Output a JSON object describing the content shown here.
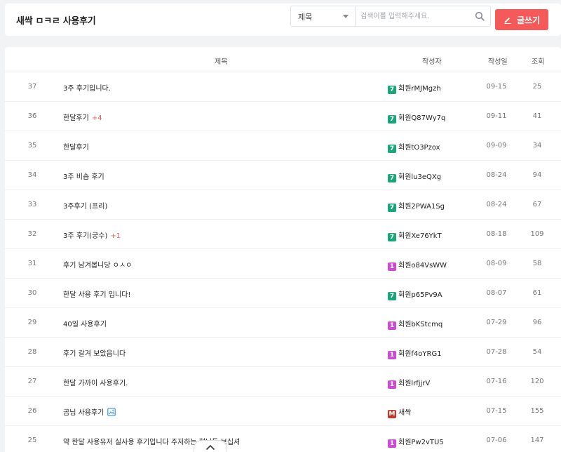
{
  "header": {
    "title": "새싹 ㅁㅋㄹ 사용후기",
    "search": {
      "scope_selected": "제목",
      "placeholder": "검색어를 입력해주세요.",
      "value": ""
    },
    "write_label": "글쓰기"
  },
  "table": {
    "columns": {
      "title": "제목",
      "author": "작성자",
      "date": "작성일",
      "views": "조회"
    },
    "rows": [
      {
        "num": "37",
        "title": "3주 후기입니다.",
        "comments": "",
        "has_image": false,
        "level": "7",
        "level_color": "#1aa67a",
        "author": "회원rMJMgzh",
        "date": "09-15",
        "views": "25"
      },
      {
        "num": "36",
        "title": "한달후기",
        "comments": "+4",
        "has_image": false,
        "level": "7",
        "level_color": "#1aa67a",
        "author": "회원Q87Wy7q",
        "date": "09-11",
        "views": "41"
      },
      {
        "num": "35",
        "title": "한달후기",
        "comments": "",
        "has_image": false,
        "level": "7",
        "level_color": "#1aa67a",
        "author": "회원tO3Pzox",
        "date": "09-09",
        "views": "34"
      },
      {
        "num": "34",
        "title": "3주 비숍 후기",
        "comments": "",
        "has_image": false,
        "level": "7",
        "level_color": "#1aa67a",
        "author": "회원lu3eQXg",
        "date": "08-24",
        "views": "94"
      },
      {
        "num": "33",
        "title": "3주후기 (프리)",
        "comments": "",
        "has_image": false,
        "level": "7",
        "level_color": "#1aa67a",
        "author": "회원2PWA1Sg",
        "date": "08-24",
        "views": "67"
      },
      {
        "num": "32",
        "title": "3주 후기(궁수)",
        "comments": "+1",
        "has_image": false,
        "level": "7",
        "level_color": "#1aa67a",
        "author": "회원Xe76YkT",
        "date": "08-18",
        "views": "109"
      },
      {
        "num": "31",
        "title": "후기 남겨봅니당 ㅇㅅㅇ",
        "comments": "",
        "has_image": false,
        "level": "1",
        "level_color": "#d04ad8",
        "author": "회원o84VsWW",
        "date": "08-09",
        "views": "58"
      },
      {
        "num": "30",
        "title": "한달 사용 후기 입니다!",
        "comments": "",
        "has_image": false,
        "level": "7",
        "level_color": "#1aa67a",
        "author": "회원p65Pv9A",
        "date": "08-07",
        "views": "61"
      },
      {
        "num": "29",
        "title": "40일 사용후기",
        "comments": "",
        "has_image": false,
        "level": "1",
        "level_color": "#d04ad8",
        "author": "회원bKStcmq",
        "date": "07-29",
        "views": "96"
      },
      {
        "num": "28",
        "title": "후기 갈겨 보았읍니다",
        "comments": "",
        "has_image": false,
        "level": "1",
        "level_color": "#d04ad8",
        "author": "회원f4oYRG1",
        "date": "07-28",
        "views": "54"
      },
      {
        "num": "27",
        "title": "한달 가까이 사용후기.",
        "comments": "",
        "has_image": false,
        "level": "1",
        "level_color": "#d04ad8",
        "author": "회원lrfjjrV",
        "date": "07-16",
        "views": "120"
      },
      {
        "num": "26",
        "title": "곰님 사용후기",
        "comments": "",
        "has_image": true,
        "level": "M",
        "level_color": "#c0392b",
        "author": "새싹",
        "date": "07-15",
        "views": "155"
      },
      {
        "num": "25",
        "title": "약 한달 사용유저 실사용 후기입니다 주저하는 형님들 보십셔",
        "comments": "",
        "has_image": false,
        "level": "1",
        "level_color": "#d04ad8",
        "author": "회원Pw2vTU5",
        "date": "07-06",
        "views": "147"
      }
    ]
  },
  "colors": {
    "accent": "#f55a5a",
    "level7": "#1aa67a",
    "level1": "#d04ad8",
    "manager": "#c0392b",
    "image_icon": "#4aa3e0"
  },
  "icons": {
    "search": "search-icon",
    "write": "pencil-icon",
    "image": "image-attachment-icon",
    "scroll_top": "chevron-up-icon"
  }
}
